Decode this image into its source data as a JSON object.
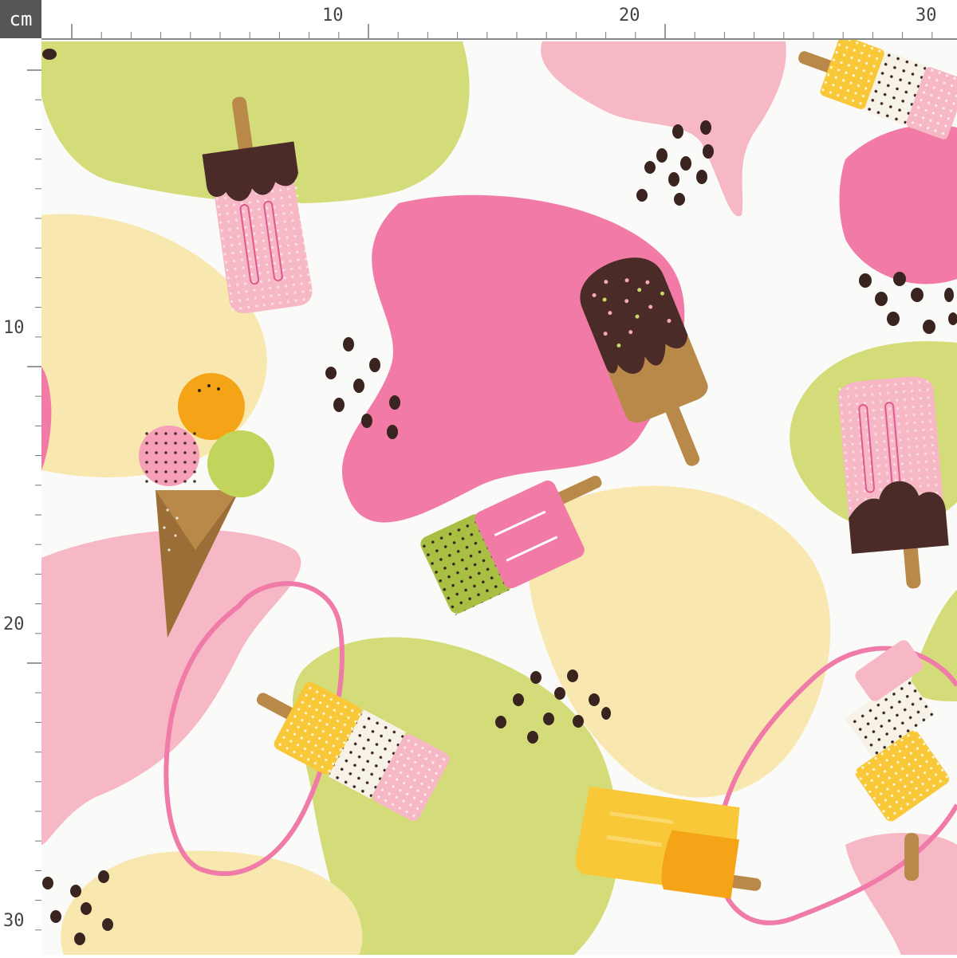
{
  "ruler": {
    "unit": "cm",
    "top_labels": [
      "10",
      "20",
      "30"
    ],
    "left_labels": [
      "10",
      "20",
      "30"
    ]
  },
  "pattern": {
    "colors": {
      "green": "#d3dc78",
      "pink_light": "#f6b8c4",
      "pink_hot": "#f27aa6",
      "yellow_light": "#f8e8b0",
      "chocolate": "#4a2b28",
      "caramel": "#b9894a",
      "orange": "#f5a418",
      "yellow": "#f8c838",
      "matcha": "#a9bf44"
    },
    "motifs": [
      "popsicle-icon",
      "ice-cream-cone-icon",
      "blob-shape",
      "chocolate-chip-dots",
      "loop-ribbon"
    ]
  }
}
